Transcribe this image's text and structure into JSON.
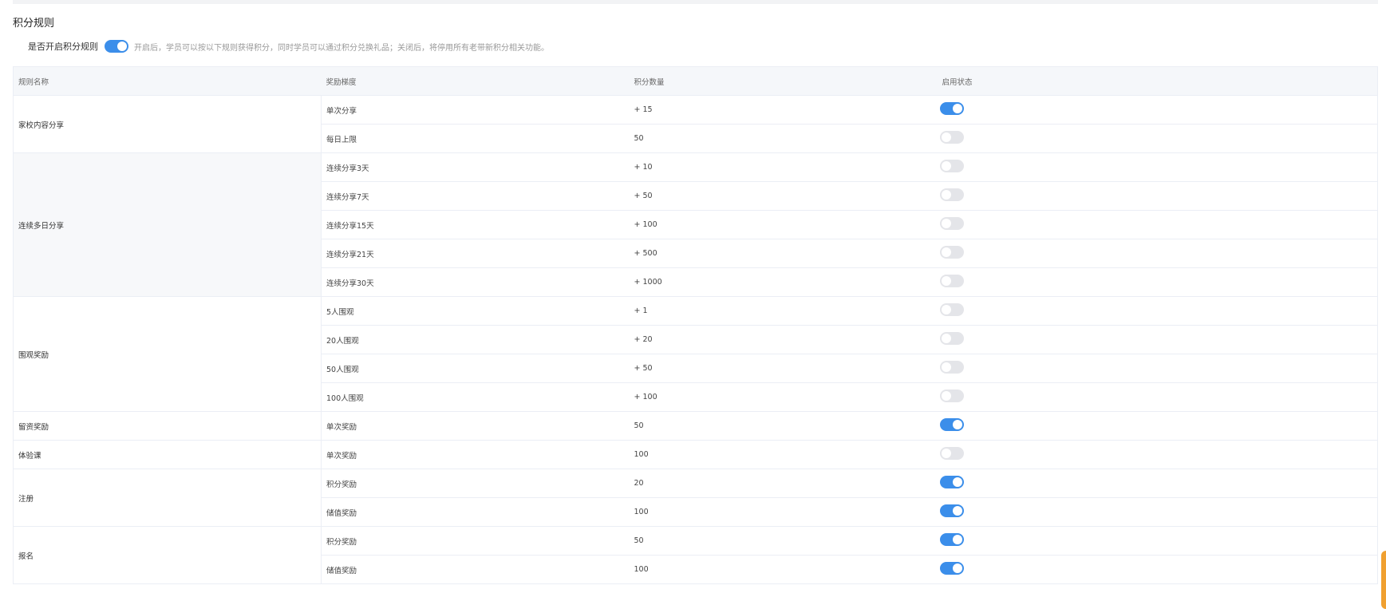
{
  "section": {
    "title": "积分规则",
    "enable_label": "是否开启积分规则",
    "enable_on": true,
    "enable_desc": "开启后，学员可以按以下规则获得积分，同时学员可以通过积分兑换礼品；关闭后，将停用所有老带新积分相关功能。"
  },
  "colors": {
    "switch_on": "#3b8eea",
    "switch_off": "#e4e5e9",
    "header_bg": "#f5f7fa",
    "accent_edge": "#f0a030"
  },
  "table": {
    "headers": [
      "规则名称",
      "奖励梯度",
      "积分数量",
      "启用状态"
    ],
    "groups": [
      {
        "name": "家校内容分享",
        "shaded": false,
        "rows": [
          {
            "tier": "单次分享",
            "points": "+ 15",
            "enabled": true
          },
          {
            "tier": "每日上限",
            "points": "50",
            "enabled": false
          }
        ]
      },
      {
        "name": "连续多日分享",
        "shaded": true,
        "rows": [
          {
            "tier": "连续分享3天",
            "points": "+ 10",
            "enabled": false
          },
          {
            "tier": "连续分享7天",
            "points": "+ 50",
            "enabled": false
          },
          {
            "tier": "连续分享15天",
            "points": "+ 100",
            "enabled": false
          },
          {
            "tier": "连续分享21天",
            "points": "+ 500",
            "enabled": false
          },
          {
            "tier": "连续分享30天",
            "points": "+ 1000",
            "enabled": false
          }
        ]
      },
      {
        "name": "围观奖励",
        "shaded": false,
        "rows": [
          {
            "tier": "5人围观",
            "points": "+ 1",
            "enabled": false
          },
          {
            "tier": "20人围观",
            "points": "+ 20",
            "enabled": false
          },
          {
            "tier": "50人围观",
            "points": "+ 50",
            "enabled": false
          },
          {
            "tier": "100人围观",
            "points": "+ 100",
            "enabled": false
          }
        ]
      },
      {
        "name": "留资奖励",
        "shaded": false,
        "rows": [
          {
            "tier": "单次奖励",
            "points": "50",
            "enabled": true
          }
        ]
      },
      {
        "name": "体验课",
        "shaded": false,
        "rows": [
          {
            "tier": "单次奖励",
            "points": "100",
            "enabled": false
          }
        ]
      },
      {
        "name": "注册",
        "shaded": false,
        "rows": [
          {
            "tier": "积分奖励",
            "points": "20",
            "enabled": true
          },
          {
            "tier": "储值奖励",
            "points": "100",
            "enabled": true
          }
        ]
      },
      {
        "name": "报名",
        "shaded": false,
        "rows": [
          {
            "tier": "积分奖励",
            "points": "50",
            "enabled": true
          },
          {
            "tier": "储值奖励",
            "points": "100",
            "enabled": true
          }
        ]
      }
    ]
  }
}
